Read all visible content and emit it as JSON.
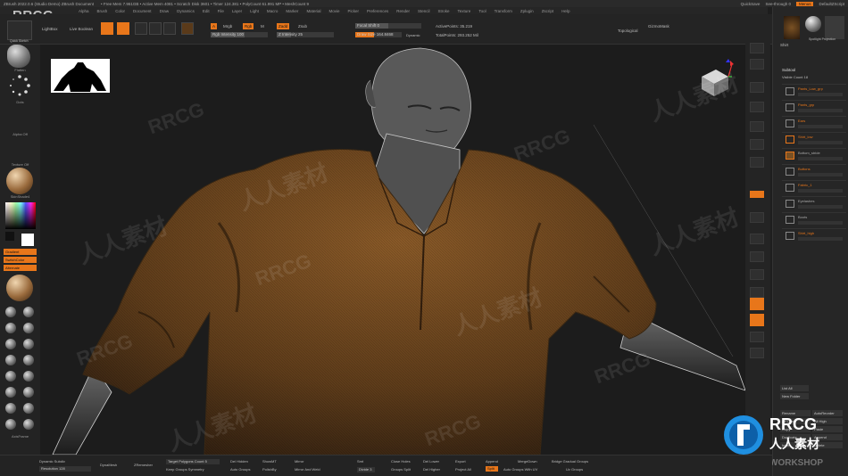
{
  "titlebar": {
    "app": "ZBrush 2022.0.6 (Studio Demo)  ZBrush Document",
    "stats": "• Free Mem 7.961GB • Active Mem 4081 • Scratch Disk 3601 • Timer 124.381 • PolyCount 61.991 MP • MeshCount 9",
    "quicksave": "QuickSave",
    "seethrough": "See-through 0",
    "menus": "Menus",
    "defaultscript": "DefaultZScript"
  },
  "logo_text": "RRCG",
  "menubar": [
    "Alpha",
    "Brush",
    "Color",
    "Document",
    "Draw",
    "Dynamics",
    "Edit",
    "File",
    "Layer",
    "Light",
    "Macro",
    "Marker",
    "Material",
    "Movie",
    "Picker",
    "Preferences",
    "Render",
    "Stencil",
    "Stroke",
    "Texture",
    "Tool",
    "Transform",
    "Zplugin",
    "Zscript",
    "Help"
  ],
  "toolbar": {
    "quicksketch": "Quick Sketch",
    "lightbox": "LightBox",
    "live_boolean": "Live Boolean",
    "edit": "Edit",
    "draw": "Draw",
    "move": "Move",
    "scale": "Scale",
    "rotate": "Rotate",
    "a": "A",
    "mrgb": "Mrgb",
    "rgb": "Rgb",
    "m": "M",
    "zadd": "Zadd",
    "zsub": "Zsub",
    "rgb_intensity": "Rgb Intensity 100",
    "z_intensity": "Z Intensity 25",
    "focal_shift": "Focal Shift 0",
    "draw_size": "Draw Size 164.8468",
    "dynamic": "Dynamic",
    "active_points": "ActivePoints: 35.219",
    "total_points": "TotalPoints: 293.252 Mil",
    "topological": "Topological",
    "gizmo_mask": "GizmoMask"
  },
  "left_panel": {
    "btn1": "Flatten",
    "btn2": "Dots",
    "alpha": "Alpha Off",
    "texture": "Texture Off",
    "material": "SkinShade4",
    "gradient": "Gradient",
    "switch_color": "SwitchColor",
    "alternate": "Alternate",
    "tools": [
      "Standard",
      "Standard",
      "ClayTubes",
      "Move",
      "hPolish",
      "Inflat",
      "Pinch",
      "TrimDyn",
      "SnakeHook",
      "Dam_Standard",
      "Smooth",
      "Slash3"
    ],
    "bottom": "AxisFrame"
  },
  "right_shelf": [
    "BPR",
    "SPix 3",
    "Scroll",
    "Zoom",
    "Actual",
    "AAHalf",
    "Persp",
    "Floor",
    "Local",
    "Frame",
    "Move",
    "Zoom3D",
    "Rotate",
    "Line Fill",
    "PolyF",
    "Transp",
    "Ghost",
    "Solo",
    "Xpose"
  ],
  "right_panel": {
    "header": "Shirt",
    "spotlight": "Spotlight Projection",
    "subtool": "Subtool",
    "visible_count": "Visible Count 18",
    "subtools": [
      "Pants_Low_grp",
      "Pants_grp",
      "Ears",
      "Shirt_low",
      "Bottom_stride",
      "Buttons",
      "Fabric_1",
      "Eyelashes",
      "Boots",
      "Shirt_high"
    ],
    "listall": "List All",
    "new_folder": "New Folder",
    "rename": "Rename",
    "autoreorder": "AutoReorder",
    "alllow": "All Low",
    "allhigh": "All High",
    "copy": "Copy",
    "paste": "Paste",
    "duplicate": "Duplicate",
    "append": "Append",
    "insert": "Insert",
    "delete": "Delete"
  },
  "bottom_bar": {
    "dynamic_subdiv": "Dynamic Subdiv",
    "resolution": "Resolution 128",
    "zremesher": "ZRemesher",
    "dynamesh": "DynaMesh",
    "target_polys": "Target Polygons Count 5",
    "adapt": "Keep Groups  Symmetry",
    "del_hidden": "Del Hidden",
    "auto_groups": "Auto Groups",
    "close_holes": "Close Holes",
    "del_lower": "Del Lower",
    "export": "Export",
    "append": "Append",
    "mirror_weld": "Mirror And Weld",
    "groups_split": "Groups Split",
    "del_higher": "Del Higher",
    "project_all": "Project All",
    "split": "Split",
    "auto_groups_uv": "Auto Groups With UV",
    "bridge": "Bridge Gradual Groups",
    "uv_groups": "Uv Groups",
    "mirror": "Mirror",
    "smt": "ShowMT",
    "polish": "PolishBy",
    "smooth": "Smt",
    "divide": "Divide 3",
    "merge": "MergeDown",
    "pt": "Pt"
  },
  "watermark": {
    "text": "RRCG",
    "cn": "人人素材",
    "badge_en": "RRCG",
    "badge_cn": "人人素材",
    "workshop": "WORKSHOP"
  },
  "colors": {
    "accent": "#e8761a",
    "panel": "#242424",
    "viewport": "#1c1c1c",
    "fabric": "#7a5124"
  }
}
